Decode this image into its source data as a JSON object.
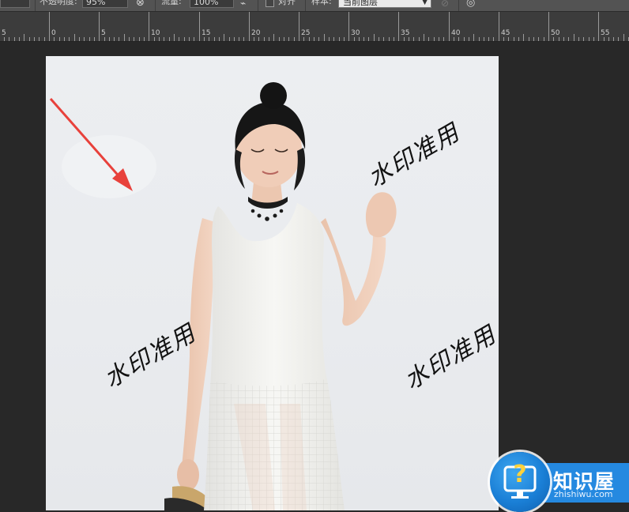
{
  "options_bar": {
    "opacity_label": "不透明度:",
    "opacity_value": "95%",
    "flow_label": "流量:",
    "flow_value": "100%",
    "align_label": "对齐",
    "sample_label": "样本:",
    "sample_value": "当前图层"
  },
  "ruler": {
    "labels": [
      "5",
      "0",
      "5",
      "10",
      "15",
      "20",
      "25",
      "30",
      "35",
      "40",
      "45",
      "50",
      "55"
    ]
  },
  "document": {
    "watermarks": [
      "水印准用",
      "水印准用",
      "水印准用"
    ],
    "arrow_color": "#e8413b"
  },
  "logo": {
    "title": "知识屋",
    "url": "zhishiwu.com",
    "icon": "question-monitor-icon"
  }
}
